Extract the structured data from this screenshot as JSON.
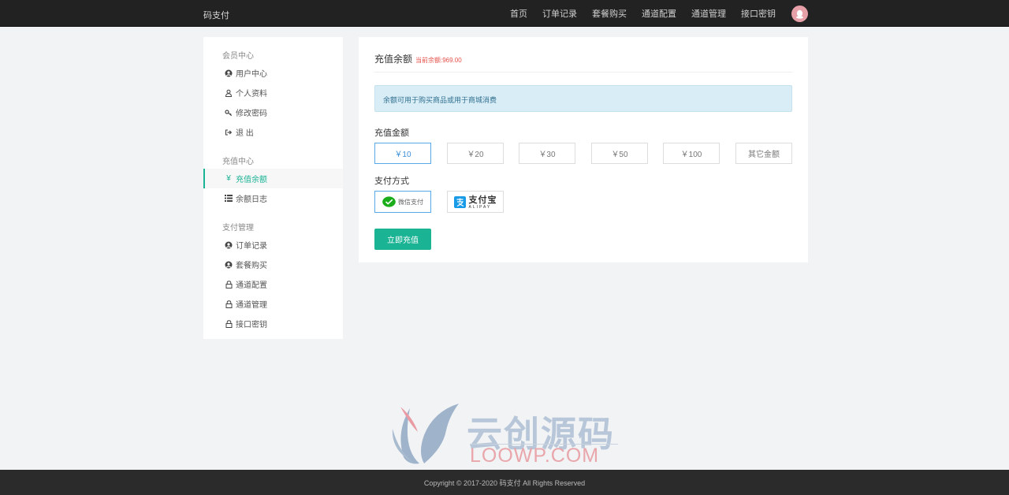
{
  "header": {
    "brand": "码支付",
    "nav": [
      "首页",
      "订单记录",
      "套餐购买",
      "通道配置",
      "通道管理",
      "接口密钥"
    ],
    "avatar_icon": "qq-avatar-icon"
  },
  "sidebar": {
    "groups": [
      {
        "title": "会员中心",
        "items": [
          {
            "label": "用户中心",
            "icon": "user-circle-icon"
          },
          {
            "label": "个人资料",
            "icon": "user-icon"
          },
          {
            "label": "修改密码",
            "icon": "key-icon"
          },
          {
            "label": "退 出",
            "icon": "sign-out-icon"
          }
        ]
      },
      {
        "title": "充值中心",
        "items": [
          {
            "label": "充值余额",
            "icon": "yen-icon"
          },
          {
            "label": "余额日志",
            "icon": "list-icon"
          }
        ]
      },
      {
        "title": "支付管理",
        "items": [
          {
            "label": "订单记录",
            "icon": "user-circle-icon"
          },
          {
            "label": "套餐购买",
            "icon": "user-circle-icon"
          },
          {
            "label": "通道配置",
            "icon": "lock-icon"
          },
          {
            "label": "通道管理",
            "icon": "lock-icon"
          },
          {
            "label": "接口密钥",
            "icon": "lock-icon"
          }
        ]
      }
    ]
  },
  "panel": {
    "title": "充值余额",
    "balance": "当前余额:969.00",
    "notice": "余额可用于购买商品或用于商城消费",
    "amount_label": "充值金额",
    "amounts": [
      "￥10",
      "￥20",
      "￥30",
      "￥50",
      "￥100",
      "其它金额"
    ],
    "selected_amount": "￥10",
    "pay_label": "支付方式",
    "pay_methods": {
      "wechat": "微信支付",
      "alipay": "支付宝",
      "alipay_sub": "ALIPAY"
    },
    "submit": "立即充值"
  },
  "watermark": {
    "cn": "云创源码",
    "en": "LOOWP.COM"
  },
  "footer": {
    "copyright": "Copyright © 2017-2020 码支付 All Rights Reserved"
  },
  "colors": {
    "accent": "#1ab394",
    "topbar": "#222222",
    "notice_bg": "#d9edf7",
    "balance": "#e5504a"
  }
}
